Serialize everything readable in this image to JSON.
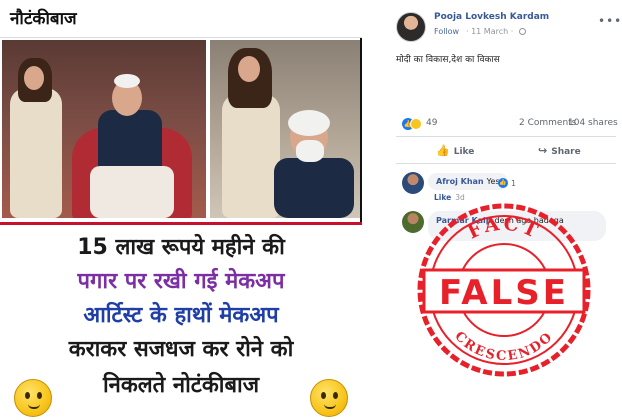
{
  "meme": {
    "title": "नौटंकीबाज",
    "lines": [
      "15 लाख रूपये महीने की",
      "पगार पर रखी गई मेकअप",
      "आर्टिस्ट के हाथों मेकअप",
      "कराकर सजधज कर रोने को",
      "निकलते नोटंकीबाज"
    ]
  },
  "post": {
    "author": "Pooja Lovkesh Kardam",
    "follow_label": "Follow",
    "date": "· 11 March ·",
    "text": "मोदी का विकास,देश का विकास",
    "reactions_count": "49",
    "comments_count": "2 Comments",
    "shares_count": "104 shares",
    "like_label": "Like",
    "share_label": "Share",
    "comments": [
      {
        "name": "Afroj Khan",
        "text": "Yes",
        "likes": "1",
        "like_label": "Like",
        "time": "3d"
      },
      {
        "name": "Parmar Kalp",
        "text": "desh age badega"
      }
    ]
  },
  "stamp": {
    "top_text": "FACT",
    "main_text": "FALSE",
    "bottom_text": "CRESCENDO",
    "color": "#e8202a"
  }
}
